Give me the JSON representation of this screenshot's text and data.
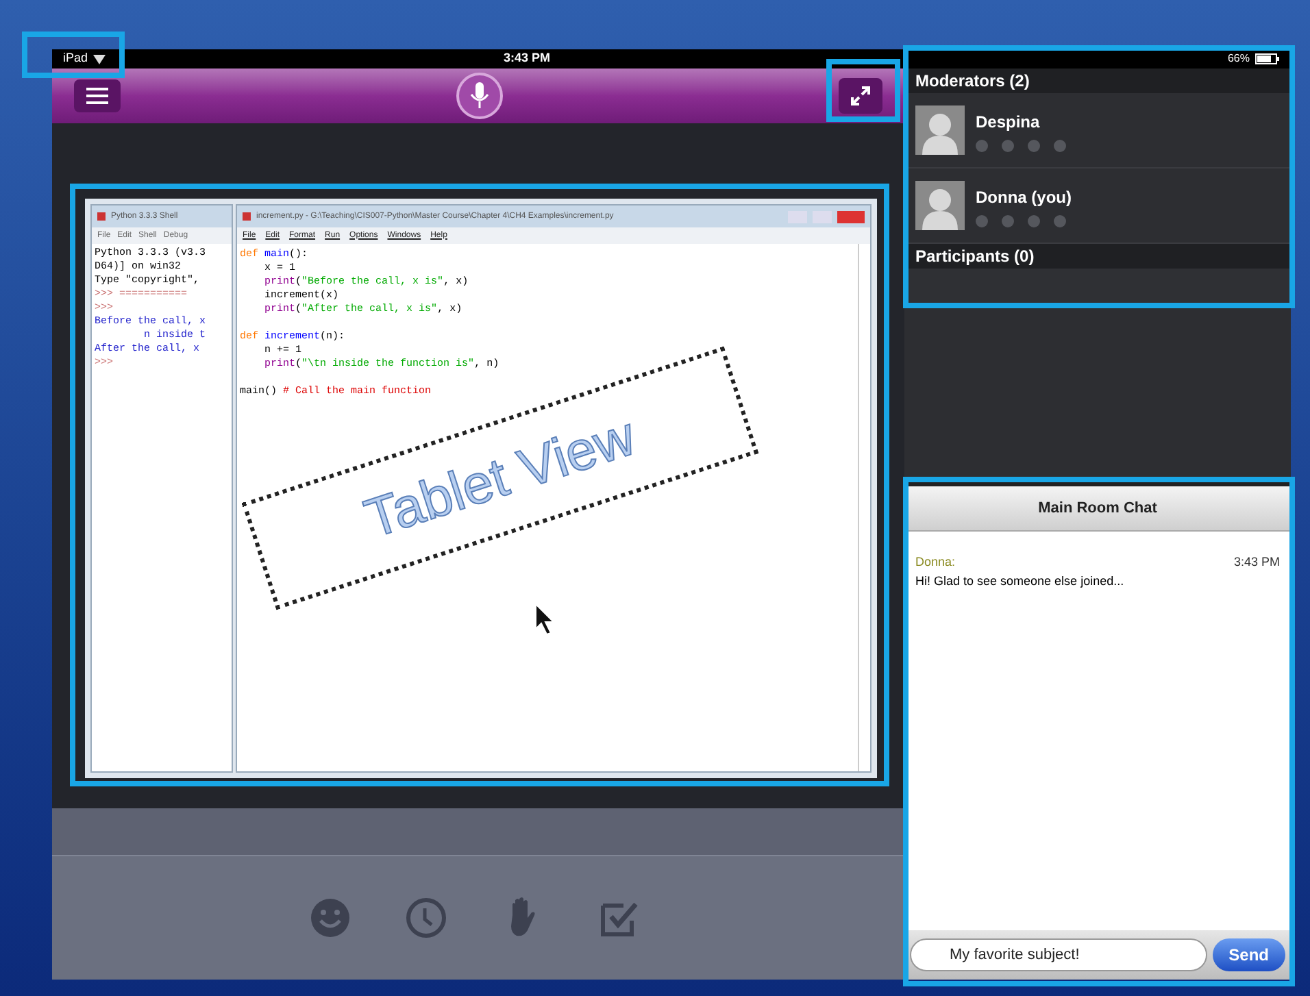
{
  "status_bar": {
    "device": "iPad",
    "time": "3:43 PM",
    "battery": "66%"
  },
  "shared_screen": {
    "shell": {
      "title": "Python 3.3.3 Shell",
      "menu": [
        "File",
        "Edit",
        "Shell",
        "Debug"
      ],
      "lines": [
        {
          "kind": "plain",
          "text": "Python 3.3.3 (v3.3"
        },
        {
          "kind": "plain",
          "text": "D64)] on win32"
        },
        {
          "kind": "plain",
          "text": "Type \"copyright\","
        },
        {
          "kind": "prompt",
          "text": ">>> ==========="
        },
        {
          "kind": "prompt",
          "text": ">>>"
        },
        {
          "kind": "output",
          "text": "Before the call, x"
        },
        {
          "kind": "output",
          "text": "        n inside t"
        },
        {
          "kind": "output",
          "text": "After the call, x"
        },
        {
          "kind": "prompt",
          "text": ">>>"
        }
      ]
    },
    "editor": {
      "title": "increment.py - G:\\Teaching\\CIS007-Python\\Master Course\\Chapter 4\\CH4 Examples\\increment.py",
      "menu": [
        "File",
        "Edit",
        "Format",
        "Run",
        "Options",
        "Windows",
        "Help"
      ],
      "lines": [
        {
          "gap_before": false,
          "segments": [
            {
              "kind": "keyword",
              "text": "def "
            },
            {
              "kind": "name",
              "text": "main"
            },
            {
              "kind": "plain",
              "text": "():"
            }
          ]
        },
        {
          "gap_before": false,
          "segments": [
            {
              "kind": "plain",
              "text": "    x = 1"
            }
          ]
        },
        {
          "gap_before": false,
          "segments": [
            {
              "kind": "builtin",
              "text": "    print"
            },
            {
              "kind": "plain",
              "text": "("
            },
            {
              "kind": "string",
              "text": "\"Before the call, x is\""
            },
            {
              "kind": "plain",
              "text": ", x)"
            }
          ]
        },
        {
          "gap_before": false,
          "segments": [
            {
              "kind": "plain",
              "text": "    increment(x)"
            }
          ]
        },
        {
          "gap_before": false,
          "segments": [
            {
              "kind": "builtin",
              "text": "    print"
            },
            {
              "kind": "plain",
              "text": "("
            },
            {
              "kind": "string",
              "text": "\"After the call, x is\""
            },
            {
              "kind": "plain",
              "text": ", x)"
            }
          ]
        },
        {
          "gap_before": true,
          "segments": [
            {
              "kind": "keyword",
              "text": "def "
            },
            {
              "kind": "name",
              "text": "increment"
            },
            {
              "kind": "plain",
              "text": "(n):"
            }
          ]
        },
        {
          "gap_before": false,
          "segments": [
            {
              "kind": "plain",
              "text": "    n += 1"
            }
          ]
        },
        {
          "gap_before": false,
          "segments": [
            {
              "kind": "builtin",
              "text": "    print"
            },
            {
              "kind": "plain",
              "text": "("
            },
            {
              "kind": "string",
              "text": "\"\\tn inside the function is\""
            },
            {
              "kind": "plain",
              "text": ", n)"
            }
          ]
        },
        {
          "gap_before": true,
          "segments": [
            {
              "kind": "plain",
              "text": "main() "
            },
            {
              "kind": "comment",
              "text": "# Call the main function"
            }
          ]
        }
      ]
    }
  },
  "annotation": {
    "text": "Tablet View"
  },
  "attendees": {
    "sections": [
      {
        "title": "Moderators (2)",
        "people": [
          {
            "name": "Despina"
          },
          {
            "name": "Donna (you)"
          }
        ]
      },
      {
        "title": "Participants (0)"
      }
    ]
  },
  "chat": {
    "title": "Main Room Chat",
    "messages": [
      {
        "author": "Donna:",
        "time": "3:43 PM",
        "text": "Hi! Glad to see someone else joined..."
      }
    ],
    "input": {
      "value": "My favorite subject!"
    },
    "send": "Send"
  }
}
